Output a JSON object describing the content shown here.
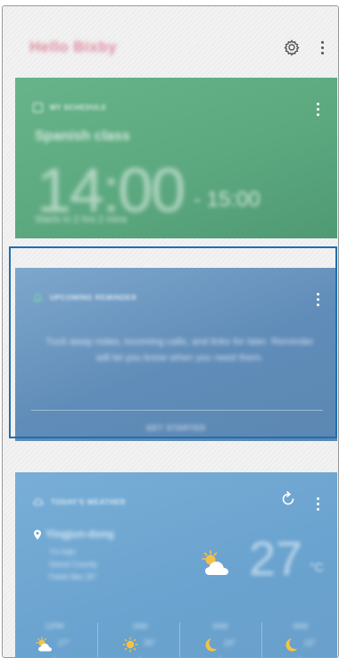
{
  "header": {
    "greeting": "Hello Bixby"
  },
  "schedule_card": {
    "label": "MY SCHEDULE",
    "event_title": "Spanish class",
    "start_time": "14:00",
    "end_time": "- 15:00",
    "subtitle": "Starts in 2 hrs 2 mins"
  },
  "reminder_card": {
    "label": "UPCOMING REMINDER",
    "body": "Tuck away notes, incoming calls, and links for later. Reminder will let you know when you need them.",
    "cta": "GET STARTED"
  },
  "weather_card": {
    "label": "TODAY'S WEATHER",
    "location": "Yingjun-dong",
    "location_lines": [
      "Yn-Ivijn",
      "Seoul County",
      "Feels like 25°"
    ],
    "temperature": "27",
    "unit": "°C",
    "forecast": [
      {
        "time": "12PM",
        "temp": "27°",
        "rain": "0",
        "icon": "partly-cloudy-icon"
      },
      {
        "time": "3AM",
        "temp": "26°",
        "rain": "0",
        "icon": "sun-icon"
      },
      {
        "time": "6AM",
        "temp": "24°",
        "rain": "0",
        "icon": "moon-icon"
      },
      {
        "time": "9AM",
        "temp": "22°",
        "rain": "0",
        "icon": "moon-icon"
      }
    ]
  },
  "colors": {
    "schedule_card": "#5ca87f",
    "reminder_card": "#5f8cb8",
    "weather_card": "#6aa3cf",
    "focus_ring": "#1f6fb0"
  }
}
